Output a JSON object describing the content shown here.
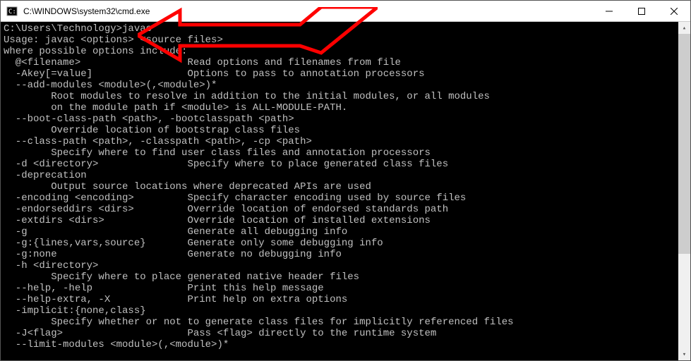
{
  "titlebar": {
    "title": "C:\\WINDOWS\\system32\\cmd.exe"
  },
  "terminal": {
    "lines": [
      "",
      "C:\\Users\\Technology>javac",
      "Usage: javac <options> <source files>",
      "where possible options include:",
      "  @<filename>                  Read options and filenames from file",
      "  -Akey[=value]                Options to pass to annotation processors",
      "  --add-modules <module>(,<module>)*",
      "        Root modules to resolve in addition to the initial modules, or all modules",
      "        on the module path if <module> is ALL-MODULE-PATH.",
      "  --boot-class-path <path>, -bootclasspath <path>",
      "        Override location of bootstrap class files",
      "  --class-path <path>, -classpath <path>, -cp <path>",
      "        Specify where to find user class files and annotation processors",
      "  -d <directory>               Specify where to place generated class files",
      "  -deprecation",
      "        Output source locations where deprecated APIs are used",
      "  -encoding <encoding>         Specify character encoding used by source files",
      "  -endorseddirs <dirs>         Override location of endorsed standards path",
      "  -extdirs <dirs>              Override location of installed extensions",
      "  -g                           Generate all debugging info",
      "  -g:{lines,vars,source}       Generate only some debugging info",
      "  -g:none                      Generate no debugging info",
      "  -h <directory>",
      "        Specify where to place generated native header files",
      "  --help, -help                Print this help message",
      "  --help-extra, -X             Print help on extra options",
      "  -implicit:{none,class}",
      "        Specify whether or not to generate class files for implicitly referenced files",
      "  -J<flag>                     Pass <flag> directly to the runtime system",
      "  --limit-modules <module>(,<module>)*"
    ]
  },
  "annotation": {
    "color": "#ff0000"
  }
}
